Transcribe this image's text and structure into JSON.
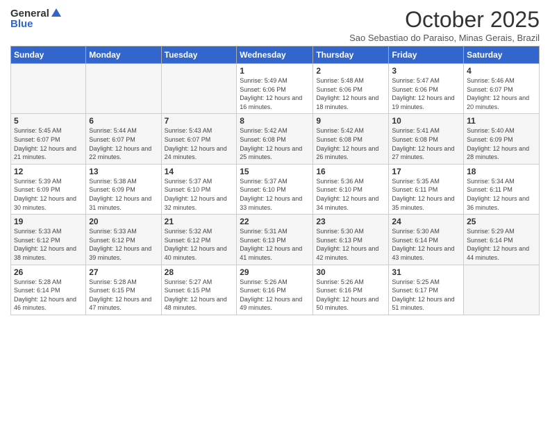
{
  "header": {
    "logo_general": "General",
    "logo_blue": "Blue",
    "month": "October 2025",
    "location": "Sao Sebastiao do Paraiso, Minas Gerais, Brazil"
  },
  "weekdays": [
    "Sunday",
    "Monday",
    "Tuesday",
    "Wednesday",
    "Thursday",
    "Friday",
    "Saturday"
  ],
  "weeks": [
    [
      {
        "day": "",
        "empty": true
      },
      {
        "day": "",
        "empty": true
      },
      {
        "day": "",
        "empty": true
      },
      {
        "day": "1",
        "sunrise": "5:49 AM",
        "sunset": "6:06 PM",
        "daylight": "12 hours and 16 minutes."
      },
      {
        "day": "2",
        "sunrise": "5:48 AM",
        "sunset": "6:06 PM",
        "daylight": "12 hours and 18 minutes."
      },
      {
        "day": "3",
        "sunrise": "5:47 AM",
        "sunset": "6:06 PM",
        "daylight": "12 hours and 19 minutes."
      },
      {
        "day": "4",
        "sunrise": "5:46 AM",
        "sunset": "6:07 PM",
        "daylight": "12 hours and 20 minutes."
      }
    ],
    [
      {
        "day": "5",
        "sunrise": "5:45 AM",
        "sunset": "6:07 PM",
        "daylight": "12 hours and 21 minutes."
      },
      {
        "day": "6",
        "sunrise": "5:44 AM",
        "sunset": "6:07 PM",
        "daylight": "12 hours and 22 minutes."
      },
      {
        "day": "7",
        "sunrise": "5:43 AM",
        "sunset": "6:07 PM",
        "daylight": "12 hours and 24 minutes."
      },
      {
        "day": "8",
        "sunrise": "5:42 AM",
        "sunset": "6:08 PM",
        "daylight": "12 hours and 25 minutes."
      },
      {
        "day": "9",
        "sunrise": "5:42 AM",
        "sunset": "6:08 PM",
        "daylight": "12 hours and 26 minutes."
      },
      {
        "day": "10",
        "sunrise": "5:41 AM",
        "sunset": "6:08 PM",
        "daylight": "12 hours and 27 minutes."
      },
      {
        "day": "11",
        "sunrise": "5:40 AM",
        "sunset": "6:09 PM",
        "daylight": "12 hours and 28 minutes."
      }
    ],
    [
      {
        "day": "12",
        "sunrise": "5:39 AM",
        "sunset": "6:09 PM",
        "daylight": "12 hours and 30 minutes."
      },
      {
        "day": "13",
        "sunrise": "5:38 AM",
        "sunset": "6:09 PM",
        "daylight": "12 hours and 31 minutes."
      },
      {
        "day": "14",
        "sunrise": "5:37 AM",
        "sunset": "6:10 PM",
        "daylight": "12 hours and 32 minutes."
      },
      {
        "day": "15",
        "sunrise": "5:37 AM",
        "sunset": "6:10 PM",
        "daylight": "12 hours and 33 minutes."
      },
      {
        "day": "16",
        "sunrise": "5:36 AM",
        "sunset": "6:10 PM",
        "daylight": "12 hours and 34 minutes."
      },
      {
        "day": "17",
        "sunrise": "5:35 AM",
        "sunset": "6:11 PM",
        "daylight": "12 hours and 35 minutes."
      },
      {
        "day": "18",
        "sunrise": "5:34 AM",
        "sunset": "6:11 PM",
        "daylight": "12 hours and 36 minutes."
      }
    ],
    [
      {
        "day": "19",
        "sunrise": "5:33 AM",
        "sunset": "6:12 PM",
        "daylight": "12 hours and 38 minutes."
      },
      {
        "day": "20",
        "sunrise": "5:33 AM",
        "sunset": "6:12 PM",
        "daylight": "12 hours and 39 minutes."
      },
      {
        "day": "21",
        "sunrise": "5:32 AM",
        "sunset": "6:12 PM",
        "daylight": "12 hours and 40 minutes."
      },
      {
        "day": "22",
        "sunrise": "5:31 AM",
        "sunset": "6:13 PM",
        "daylight": "12 hours and 41 minutes."
      },
      {
        "day": "23",
        "sunrise": "5:30 AM",
        "sunset": "6:13 PM",
        "daylight": "12 hours and 42 minutes."
      },
      {
        "day": "24",
        "sunrise": "5:30 AM",
        "sunset": "6:14 PM",
        "daylight": "12 hours and 43 minutes."
      },
      {
        "day": "25",
        "sunrise": "5:29 AM",
        "sunset": "6:14 PM",
        "daylight": "12 hours and 44 minutes."
      }
    ],
    [
      {
        "day": "26",
        "sunrise": "5:28 AM",
        "sunset": "6:14 PM",
        "daylight": "12 hours and 46 minutes."
      },
      {
        "day": "27",
        "sunrise": "5:28 AM",
        "sunset": "6:15 PM",
        "daylight": "12 hours and 47 minutes."
      },
      {
        "day": "28",
        "sunrise": "5:27 AM",
        "sunset": "6:15 PM",
        "daylight": "12 hours and 48 minutes."
      },
      {
        "day": "29",
        "sunrise": "5:26 AM",
        "sunset": "6:16 PM",
        "daylight": "12 hours and 49 minutes."
      },
      {
        "day": "30",
        "sunrise": "5:26 AM",
        "sunset": "6:16 PM",
        "daylight": "12 hours and 50 minutes."
      },
      {
        "day": "31",
        "sunrise": "5:25 AM",
        "sunset": "6:17 PM",
        "daylight": "12 hours and 51 minutes."
      },
      {
        "day": "",
        "empty": true
      }
    ]
  ]
}
